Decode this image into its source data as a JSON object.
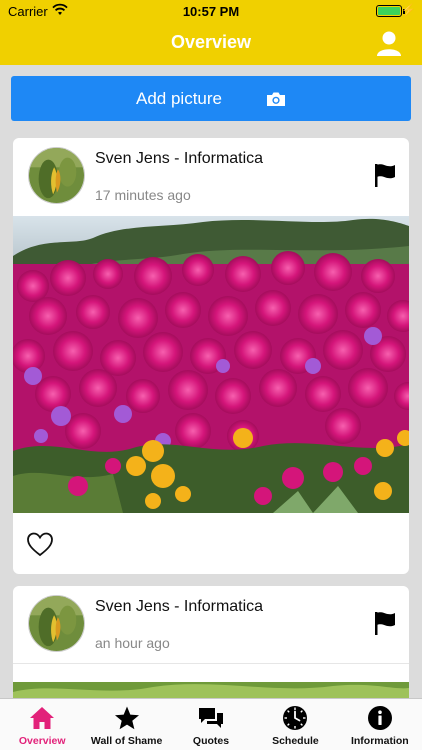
{
  "status_bar": {
    "carrier": "Carrier",
    "time": "10:57 PM"
  },
  "nav": {
    "title": "Overview",
    "profile_icon": "person-icon"
  },
  "add_picture": {
    "label": "Add picture",
    "icon": "camera-icon"
  },
  "posts": [
    {
      "author": "Sven Jens - Informatica",
      "time_ago": "17 minutes ago",
      "liked": false
    },
    {
      "author": "Sven Jens - Informatica",
      "time_ago": "an hour ago"
    }
  ],
  "tabs": [
    {
      "label": "Overview",
      "icon": "home-icon",
      "active": true
    },
    {
      "label": "Wall of Shame",
      "icon": "star-icon"
    },
    {
      "label": "Quotes",
      "icon": "chat-icon"
    },
    {
      "label": "Schedule",
      "icon": "clock-icon"
    },
    {
      "label": "Information",
      "icon": "info-icon"
    }
  ],
  "colors": {
    "nav_bar": "#f0d000",
    "button": "#1e88f5",
    "active_tab": "#e2227a",
    "background": "#dcdcdc"
  }
}
